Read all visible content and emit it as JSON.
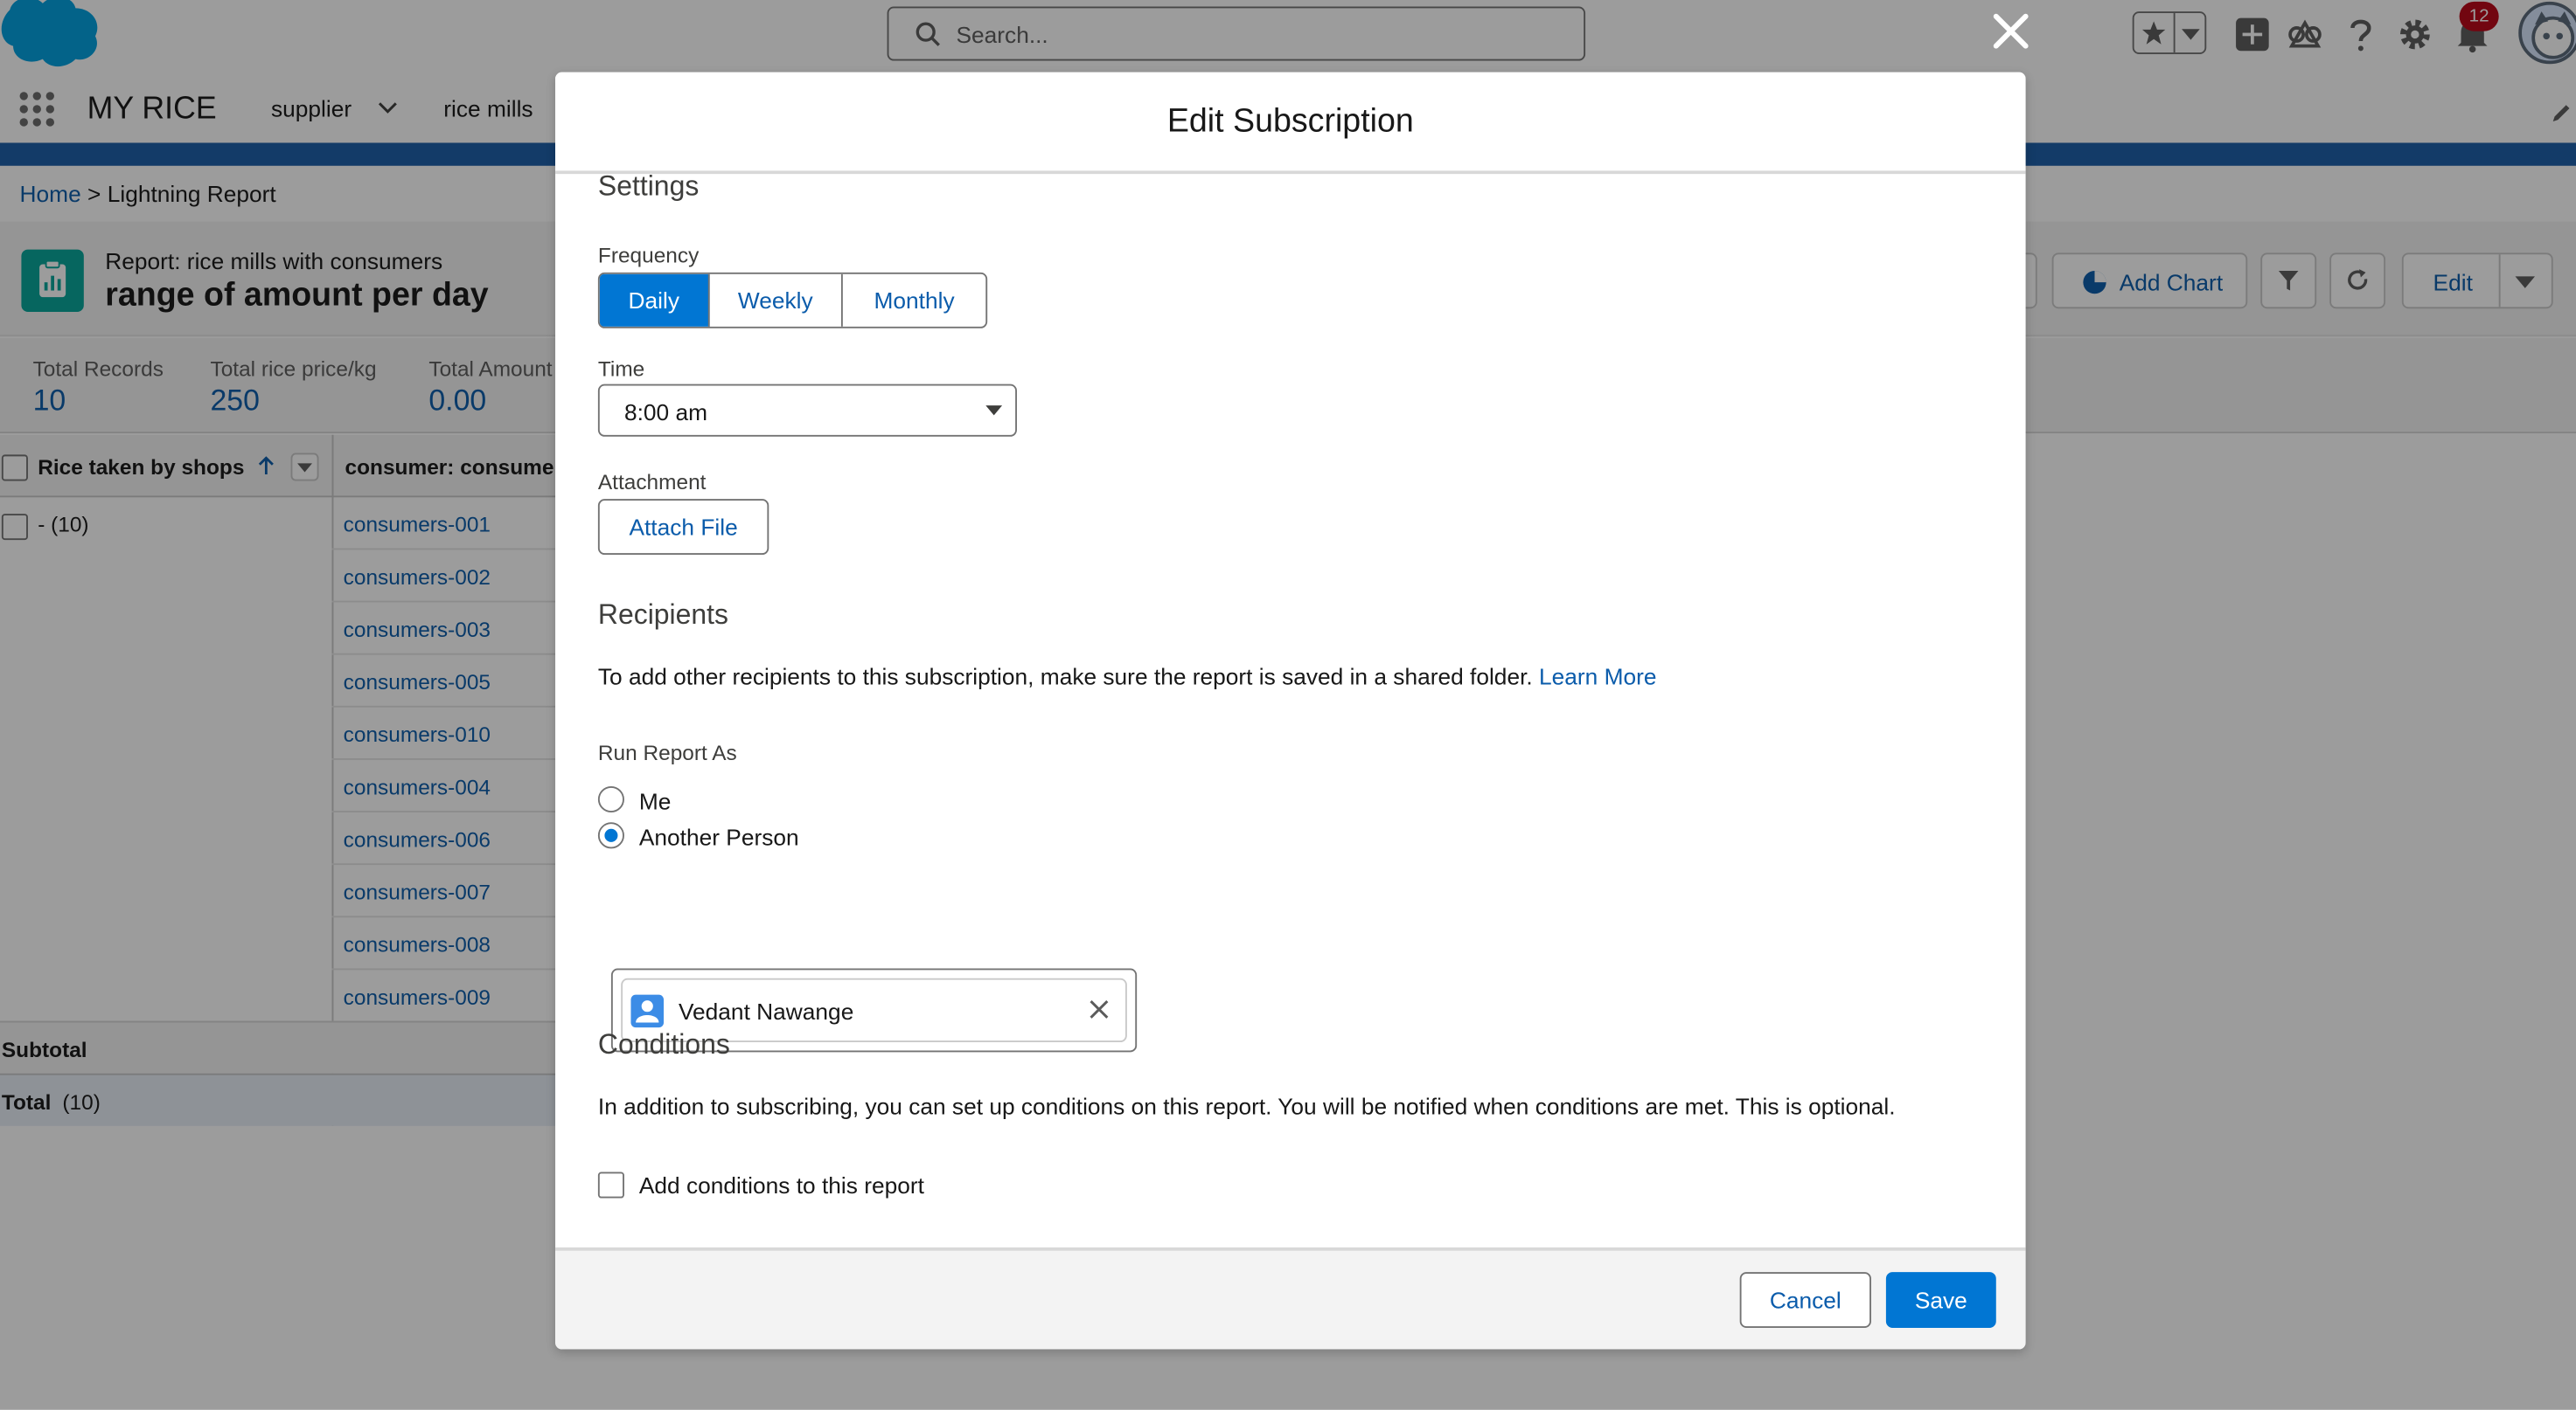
{
  "search": {
    "placeholder": "Search..."
  },
  "notifications": {
    "count": "12"
  },
  "nav": {
    "app_name": "MY RICE",
    "items": [
      "supplier",
      "rice mills"
    ]
  },
  "breadcrumb": {
    "home": "Home",
    "current": "> Lightning Report"
  },
  "report": {
    "subtitle": "Report: rice mills with consumers",
    "title": "range of amount per day",
    "buttons": {
      "add_chart": "Add Chart",
      "edit": "Edit"
    }
  },
  "totals": [
    {
      "label": "Total Records",
      "value": "10"
    },
    {
      "label": "Total rice price/kg",
      "value": "250"
    },
    {
      "label": "Total Amount",
      "value": "0.00"
    }
  ],
  "table": {
    "headers": [
      "Rice taken by shops",
      "consumer: consume"
    ],
    "group_label": "- (10)",
    "rows": [
      "consumers-001",
      "consumers-002",
      "consumers-003",
      "consumers-005",
      "consumers-010",
      "consumers-004",
      "consumers-006",
      "consumers-007",
      "consumers-008",
      "consumers-009"
    ],
    "subtotal": "Subtotal",
    "total_label": "Total",
    "total_count": "(10)"
  },
  "modal": {
    "title": "Edit Subscription",
    "settings_title": "Settings",
    "frequency_label": "Frequency",
    "frequency_options": [
      "Daily",
      "Weekly",
      "Monthly"
    ],
    "frequency_selected": "Daily",
    "time_label": "Time",
    "time_value": "8:00 am",
    "attachment_label": "Attachment",
    "attach_button": "Attach File",
    "recipients_title": "Recipients",
    "recipients_text": "To add other recipients to this subscription, make sure the report is saved in a shared folder.",
    "learn_more": "Learn More",
    "run_as_label": "Run Report As",
    "run_as_options": [
      "Me",
      "Another Person"
    ],
    "run_as_selected": "Another Person",
    "person": "Vedant Nawange",
    "conditions_title": "Conditions",
    "conditions_text": "In addition to subscribing, you can set up conditions on this report. You will be notified when conditions are met. This is optional.",
    "add_conditions_label": "Add conditions to this report",
    "add_conditions_checked": false,
    "cancel": "Cancel",
    "save": "Save"
  },
  "colors": {
    "brand": "#0176d3",
    "link": "#0b5cab",
    "nav_stripe": "#1b5ea8",
    "report_icon": "#06a59a",
    "badge": "#ba0517"
  },
  "icons": [
    "salesforce-cloud-icon",
    "search-icon",
    "close-icon",
    "star-icon",
    "chevron-down-icon",
    "plus-icon",
    "trailhead-icon",
    "help-icon",
    "gear-icon",
    "bell-icon",
    "app-launcher-icon",
    "pencil-icon",
    "report-icon",
    "chart-icon",
    "filter-icon",
    "refresh-icon",
    "sort-arrow-icon",
    "user-icon",
    "clear-icon"
  ]
}
